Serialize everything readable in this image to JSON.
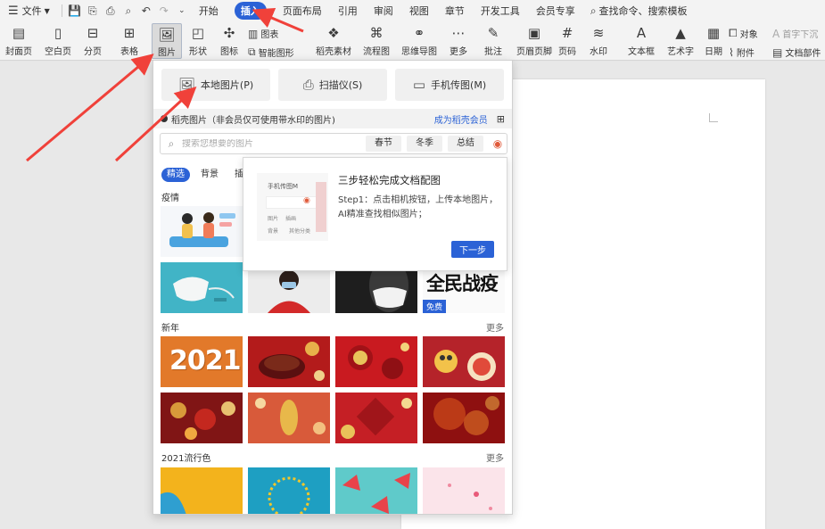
{
  "menubar": {
    "file": "文件",
    "tabs": [
      "开始",
      "插入",
      "页面布局",
      "引用",
      "审阅",
      "视图",
      "章节",
      "开发工具",
      "会员专享"
    ],
    "active_tab": "插入",
    "search_text": "查找命令、搜索模板"
  },
  "ribbon": {
    "cover": "封面页",
    "blank": "空白页",
    "section_break": "分页",
    "table": "表格",
    "picture": "图片",
    "shape": "形状",
    "icon": "图标",
    "chart": "图表",
    "smart_art": "智能图形",
    "daoke": "稻壳素材",
    "flowchart": "流程图",
    "mindmap": "思维导图",
    "more": "更多",
    "comment": "批注",
    "header_footer": "页眉页脚",
    "page_number": "页码",
    "watermark": "水印",
    "textbox": "文本框",
    "wordart": "艺术字",
    "date": "日期",
    "object": "对象",
    "attachment": "附件",
    "drop_cap": "首字下沉",
    "doc_parts": "文档部件"
  },
  "panel": {
    "local_picture": "本地图片(P)",
    "scanner": "扫描仪(S)",
    "phone_picture": "手机传图(M)",
    "library_label": "稻壳图片（非会员仅可使用带水印的图片)",
    "become_member": "成为稻壳会员",
    "search_placeholder": "搜索您想要的图片",
    "search_tags": [
      "春节",
      "冬季",
      "总结"
    ],
    "category_tabs": [
      "精选",
      "背景",
      "插"
    ],
    "sections": {
      "epidemic": "疫情",
      "new_year": "新年",
      "popular_colors": "2021流行色"
    },
    "more_label": "更多",
    "free_badge": "免费",
    "year_thumb_text": "2021",
    "calligraphy_text": "全民战疫"
  },
  "tooltip": {
    "title": "三步轻松完成文档配图",
    "body": "Step1：点击相机按钮，上传本地图片，AI精准查找相似图片；",
    "next_button": "下一步",
    "preview_title": "手机传图M",
    "preview_items": [
      "图片",
      "插画",
      "背景",
      "其他分类"
    ]
  },
  "colors": {
    "accent": "#2b62d6",
    "arrow": "#f0413a"
  }
}
